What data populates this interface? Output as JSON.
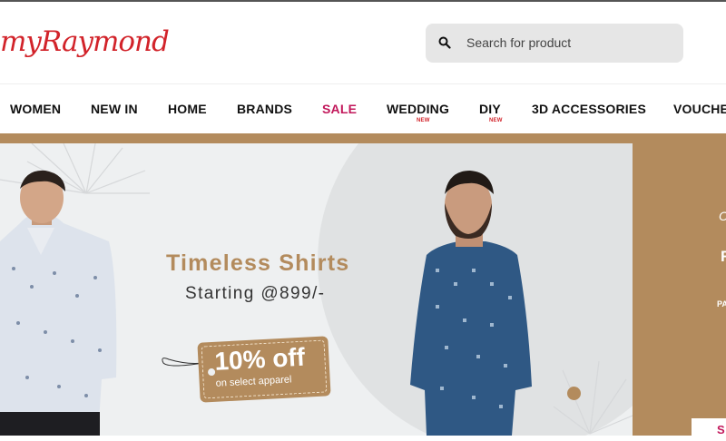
{
  "header": {
    "logo_text": "myRaymond",
    "search_placeholder": "Search for product",
    "search_icon": "search-icon"
  },
  "nav": {
    "items": [
      {
        "label": "WOMEN"
      },
      {
        "label": "NEW IN"
      },
      {
        "label": "HOME"
      },
      {
        "label": "BRANDS"
      },
      {
        "label": "SALE"
      },
      {
        "label": "WEDDING",
        "badge": "NEW"
      },
      {
        "label": "DIY",
        "badge": "NEW"
      },
      {
        "label": "3D ACCESSORIES"
      },
      {
        "label": "VOUCHE"
      }
    ]
  },
  "banner": {
    "headline": "Timeless Shirts",
    "subheadline": "Starting @899/-",
    "tag_big": "10% off",
    "tag_small": "on select apparel"
  },
  "side_banner": {
    "text_1": "C",
    "text_2": "R",
    "text_3": "PA",
    "button_label": "S"
  },
  "colors": {
    "brand_red": "#d2232a",
    "sale_pink": "#c2185b",
    "accent_brown": "#b38b5d"
  }
}
